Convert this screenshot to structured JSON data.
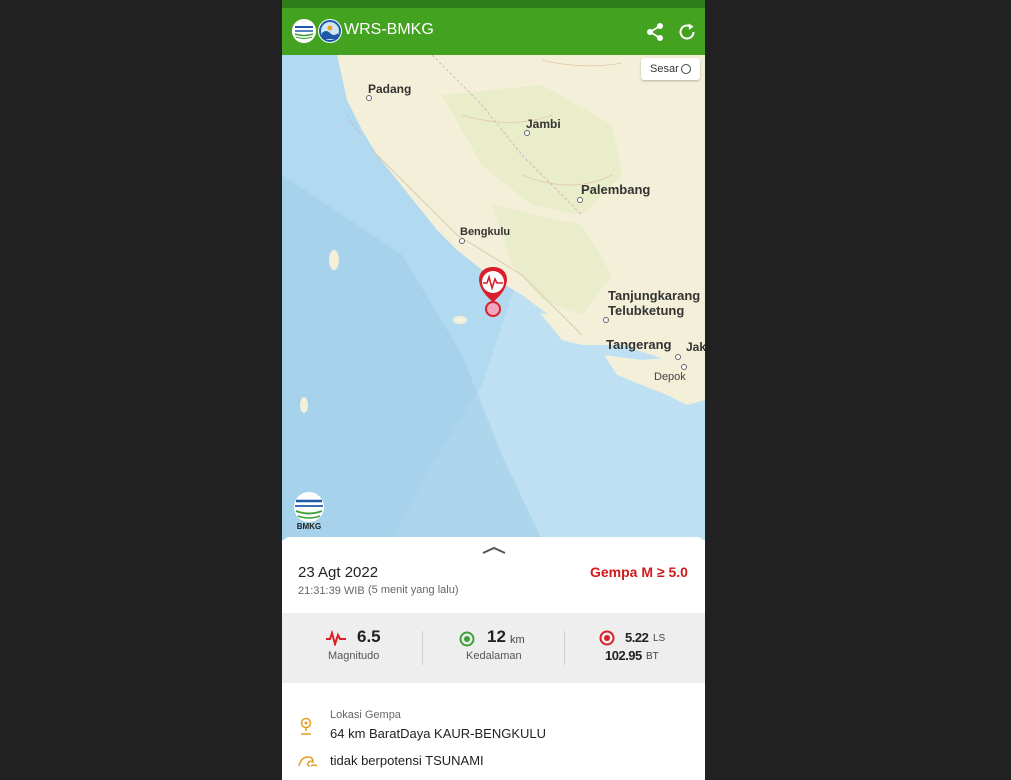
{
  "app": {
    "title": "WRS-BMKG",
    "accent": "#43a21f",
    "accent_dark": "#2e7d1a"
  },
  "toolbar": {
    "share_icon": "share-icon",
    "refresh_icon": "refresh-icon"
  },
  "map": {
    "sesar_label": "Sesar",
    "logo_text": "BMKG",
    "cities": {
      "padang": "Padang",
      "jambi": "Jambi",
      "palembang": "Palembang",
      "bengkulu": "Bengkulu",
      "tanjungkarang": "Tanjungkarang",
      "telukbetung": "Telubketung",
      "tangerang": "Tangerang",
      "jak": "Jak",
      "depok": "Depok"
    },
    "marker_icon": "seismic-marker-icon",
    "marker_color": "#d9202a"
  },
  "quake": {
    "date": "23 Agt 2022",
    "time": "21:31:39 WIB",
    "ago": "(5 menit yang lalu)",
    "badge": "Gempa M ≥ 5.0",
    "badge_color": "#d11a1a",
    "magnitude": "6.5",
    "magnitude_label": "Magnitudo",
    "depth": "12",
    "depth_unit": "km",
    "depth_label": "Kedalaman",
    "lat": "5.22",
    "lat_unit": "LS",
    "lon": "102.95",
    "lon_unit": "BT",
    "location_title": "Lokasi Gempa",
    "location": "64 km BaratDaya KAUR-BENGKULU",
    "tsunami": "tidak berpotensi TSUNAMI"
  }
}
